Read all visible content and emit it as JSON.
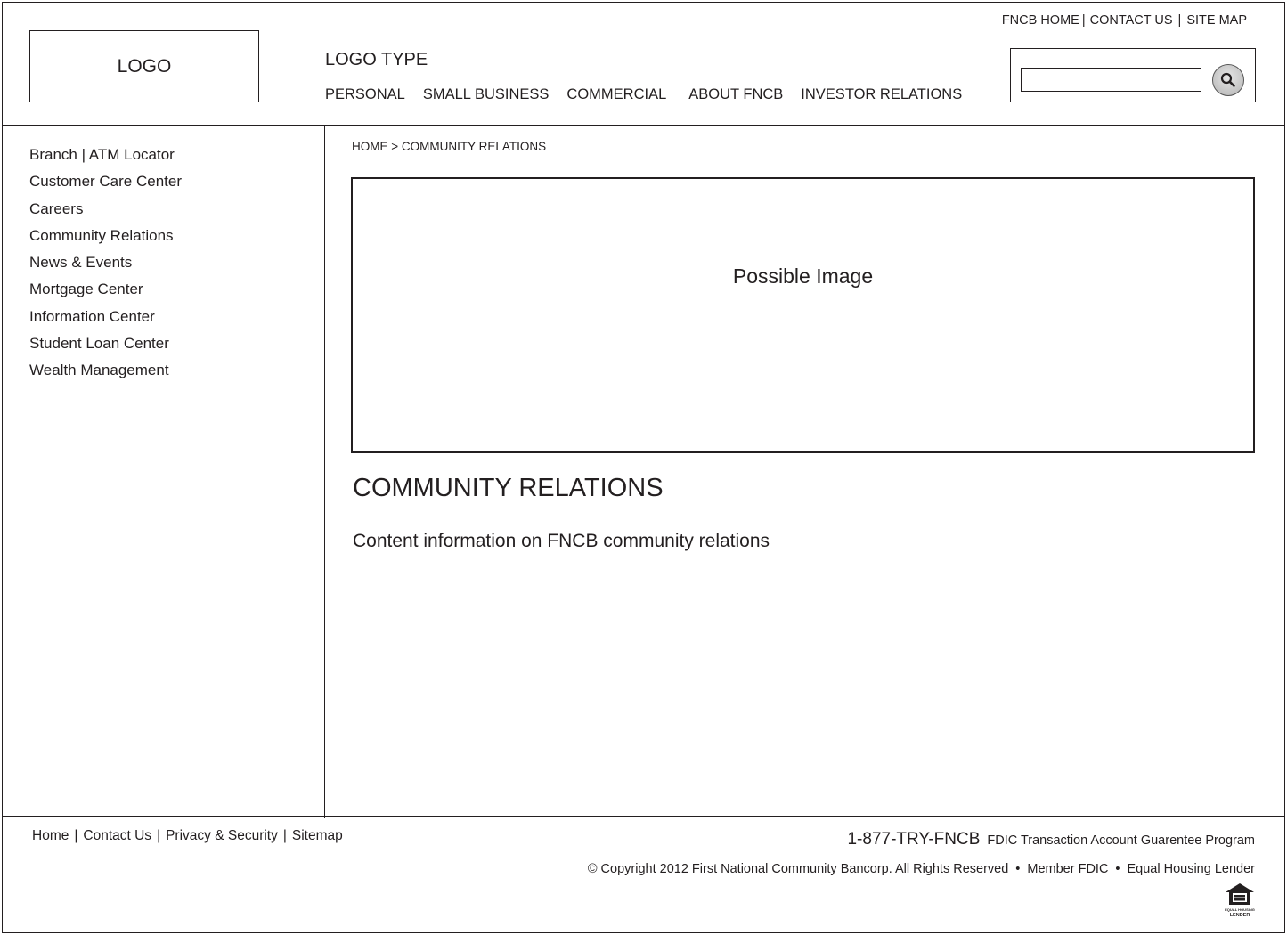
{
  "header": {
    "logo": "LOGO",
    "logo_type": "LOGO TYPE",
    "nav": [
      "PERSONAL",
      "SMALL BUSINESS",
      "COMMERCIAL",
      "ABOUT FNCB",
      "INVESTOR RELATIONS"
    ],
    "utility_links": [
      "FNCB HOME",
      "CONTACT US",
      "SITE MAP"
    ],
    "search": {
      "value": "",
      "icon": "search-icon"
    }
  },
  "sidebar": {
    "items": [
      "Branch | ATM Locator",
      "Customer Care Center",
      "Careers",
      "Community Relations",
      "News & Events",
      "Mortgage Center",
      "Information Center",
      "Student Loan Center",
      "Wealth Management"
    ]
  },
  "main": {
    "breadcrumb": "HOME > COMMUNITY RELATIONS",
    "hero_placeholder": "Possible Image",
    "title": "COMMUNITY RELATIONS",
    "content": "Content information on FNCB community relations"
  },
  "footer": {
    "links": [
      "Home",
      "Contact Us",
      "Privacy & Security",
      "Sitemap"
    ],
    "phone": "1-877-TRY-FNCB",
    "fdic_program": "FDIC Transaction Account Guarentee Program",
    "copyright": "© Copyright 2012 First National Community Bancorp. All Rights Reserved",
    "member_fdic": "Member FDIC",
    "equal_housing": "Equal Housing Lender",
    "equal_housing_logo": "equal-housing-lender-icon",
    "equal_housing_logo_text": "EQUAL HOUSING LENDER"
  }
}
